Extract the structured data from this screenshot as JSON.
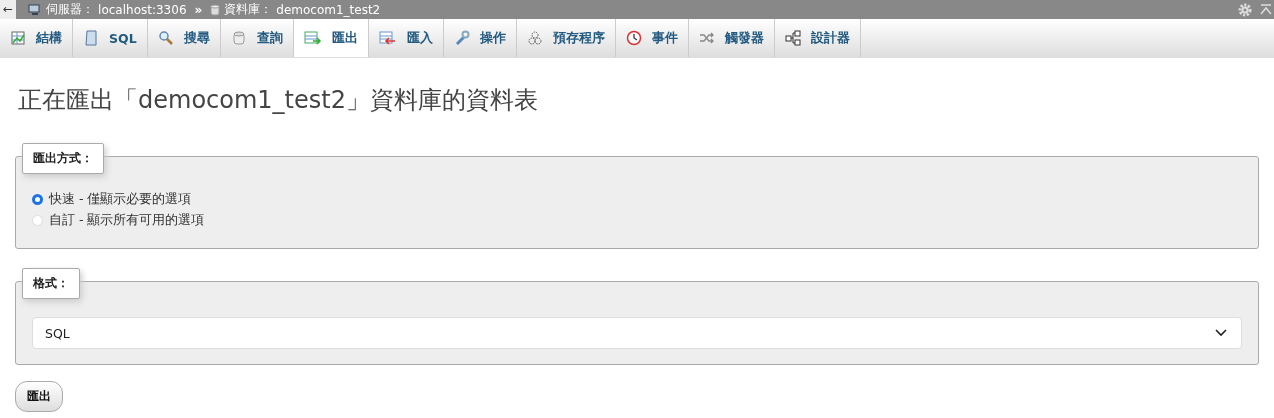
{
  "breadcrumb": {
    "back": "←",
    "server_label": "伺服器：",
    "server": "localhost:3306",
    "separator": "»",
    "db_label": "資料庫：",
    "database": "democom1_test2"
  },
  "tabs": [
    {
      "label": "結構",
      "selected": false
    },
    {
      "label": "SQL",
      "selected": false
    },
    {
      "label": "搜尋",
      "selected": false
    },
    {
      "label": "查詢",
      "selected": false
    },
    {
      "label": "匯出",
      "selected": true
    },
    {
      "label": "匯入",
      "selected": false
    },
    {
      "label": "操作",
      "selected": false
    },
    {
      "label": "預存程序",
      "selected": false
    },
    {
      "label": "事件",
      "selected": false
    },
    {
      "label": "觸發器",
      "selected": false
    },
    {
      "label": "設計器",
      "selected": false
    }
  ],
  "heading": "正在匯出「democom1_test2」資料庫的資料表",
  "method": {
    "legend": "匯出方式：",
    "options": [
      {
        "label": "快速 - 僅顯示必要的選項",
        "selected": true
      },
      {
        "label": "自訂 - 顯示所有可用的選項",
        "selected": false
      }
    ]
  },
  "format": {
    "legend": "格式：",
    "value": "SQL"
  },
  "submit": "匯出"
}
